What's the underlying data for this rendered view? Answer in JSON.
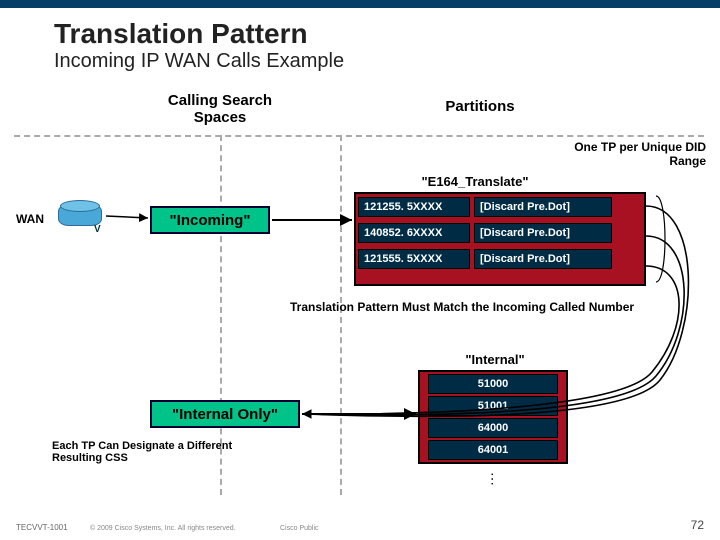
{
  "title": "Translation Pattern",
  "subtitle": "Incoming IP WAN Calls Example",
  "columns": {
    "css": "Calling Search Spaces",
    "part": "Partitions"
  },
  "notes": {
    "unique": "One TP per Unique DID Range",
    "match": "Translation Pattern Must Match the Incoming Called Number",
    "each_tp": "Each TP Can Designate a Different Resulting CSS"
  },
  "wan_label": "WAN",
  "router_v": "V",
  "partitions": {
    "e164": "\"E164_Translate\"",
    "internal": "\"Internal\""
  },
  "css_boxes": {
    "incoming": "\"Incoming\"",
    "internal_only": "\"Internal Only\""
  },
  "tp_rows": [
    {
      "pattern": "121255. 5XXXX",
      "action": "[Discard Pre.Dot]"
    },
    {
      "pattern": "140852. 6XXXX",
      "action": "[Discard Pre.Dot]"
    },
    {
      "pattern": "121555. 5XXXX",
      "action": "[Discard Pre.Dot]"
    }
  ],
  "dn_list": [
    "51000",
    "51001",
    "64000",
    "64001"
  ],
  "footer": {
    "id": "TECVVT-1001",
    "copyright": "© 2009 Cisco Systems, Inc. All rights reserved.",
    "public": "Cisco Public",
    "page": "72"
  },
  "chart_data": {
    "type": "table",
    "title": "Translation Pattern — Incoming IP WAN Calls Example",
    "calling_search_spaces": [
      "Incoming",
      "Internal Only"
    ],
    "partitions": {
      "E164_Translate": [
        {
          "pattern": "121255.5XXXX",
          "digit_discard": "PreDot"
        },
        {
          "pattern": "140852.6XXXX",
          "digit_discard": "PreDot"
        },
        {
          "pattern": "121555.5XXXX",
          "digit_discard": "PreDot"
        }
      ],
      "Internal": [
        "51000",
        "51001",
        "64000",
        "64001"
      ]
    },
    "relationships": [
      "WAN → Incoming CSS → E164_Translate partition",
      "Translation Patterns → Internal Only CSS → Internal partition DNs"
    ]
  }
}
